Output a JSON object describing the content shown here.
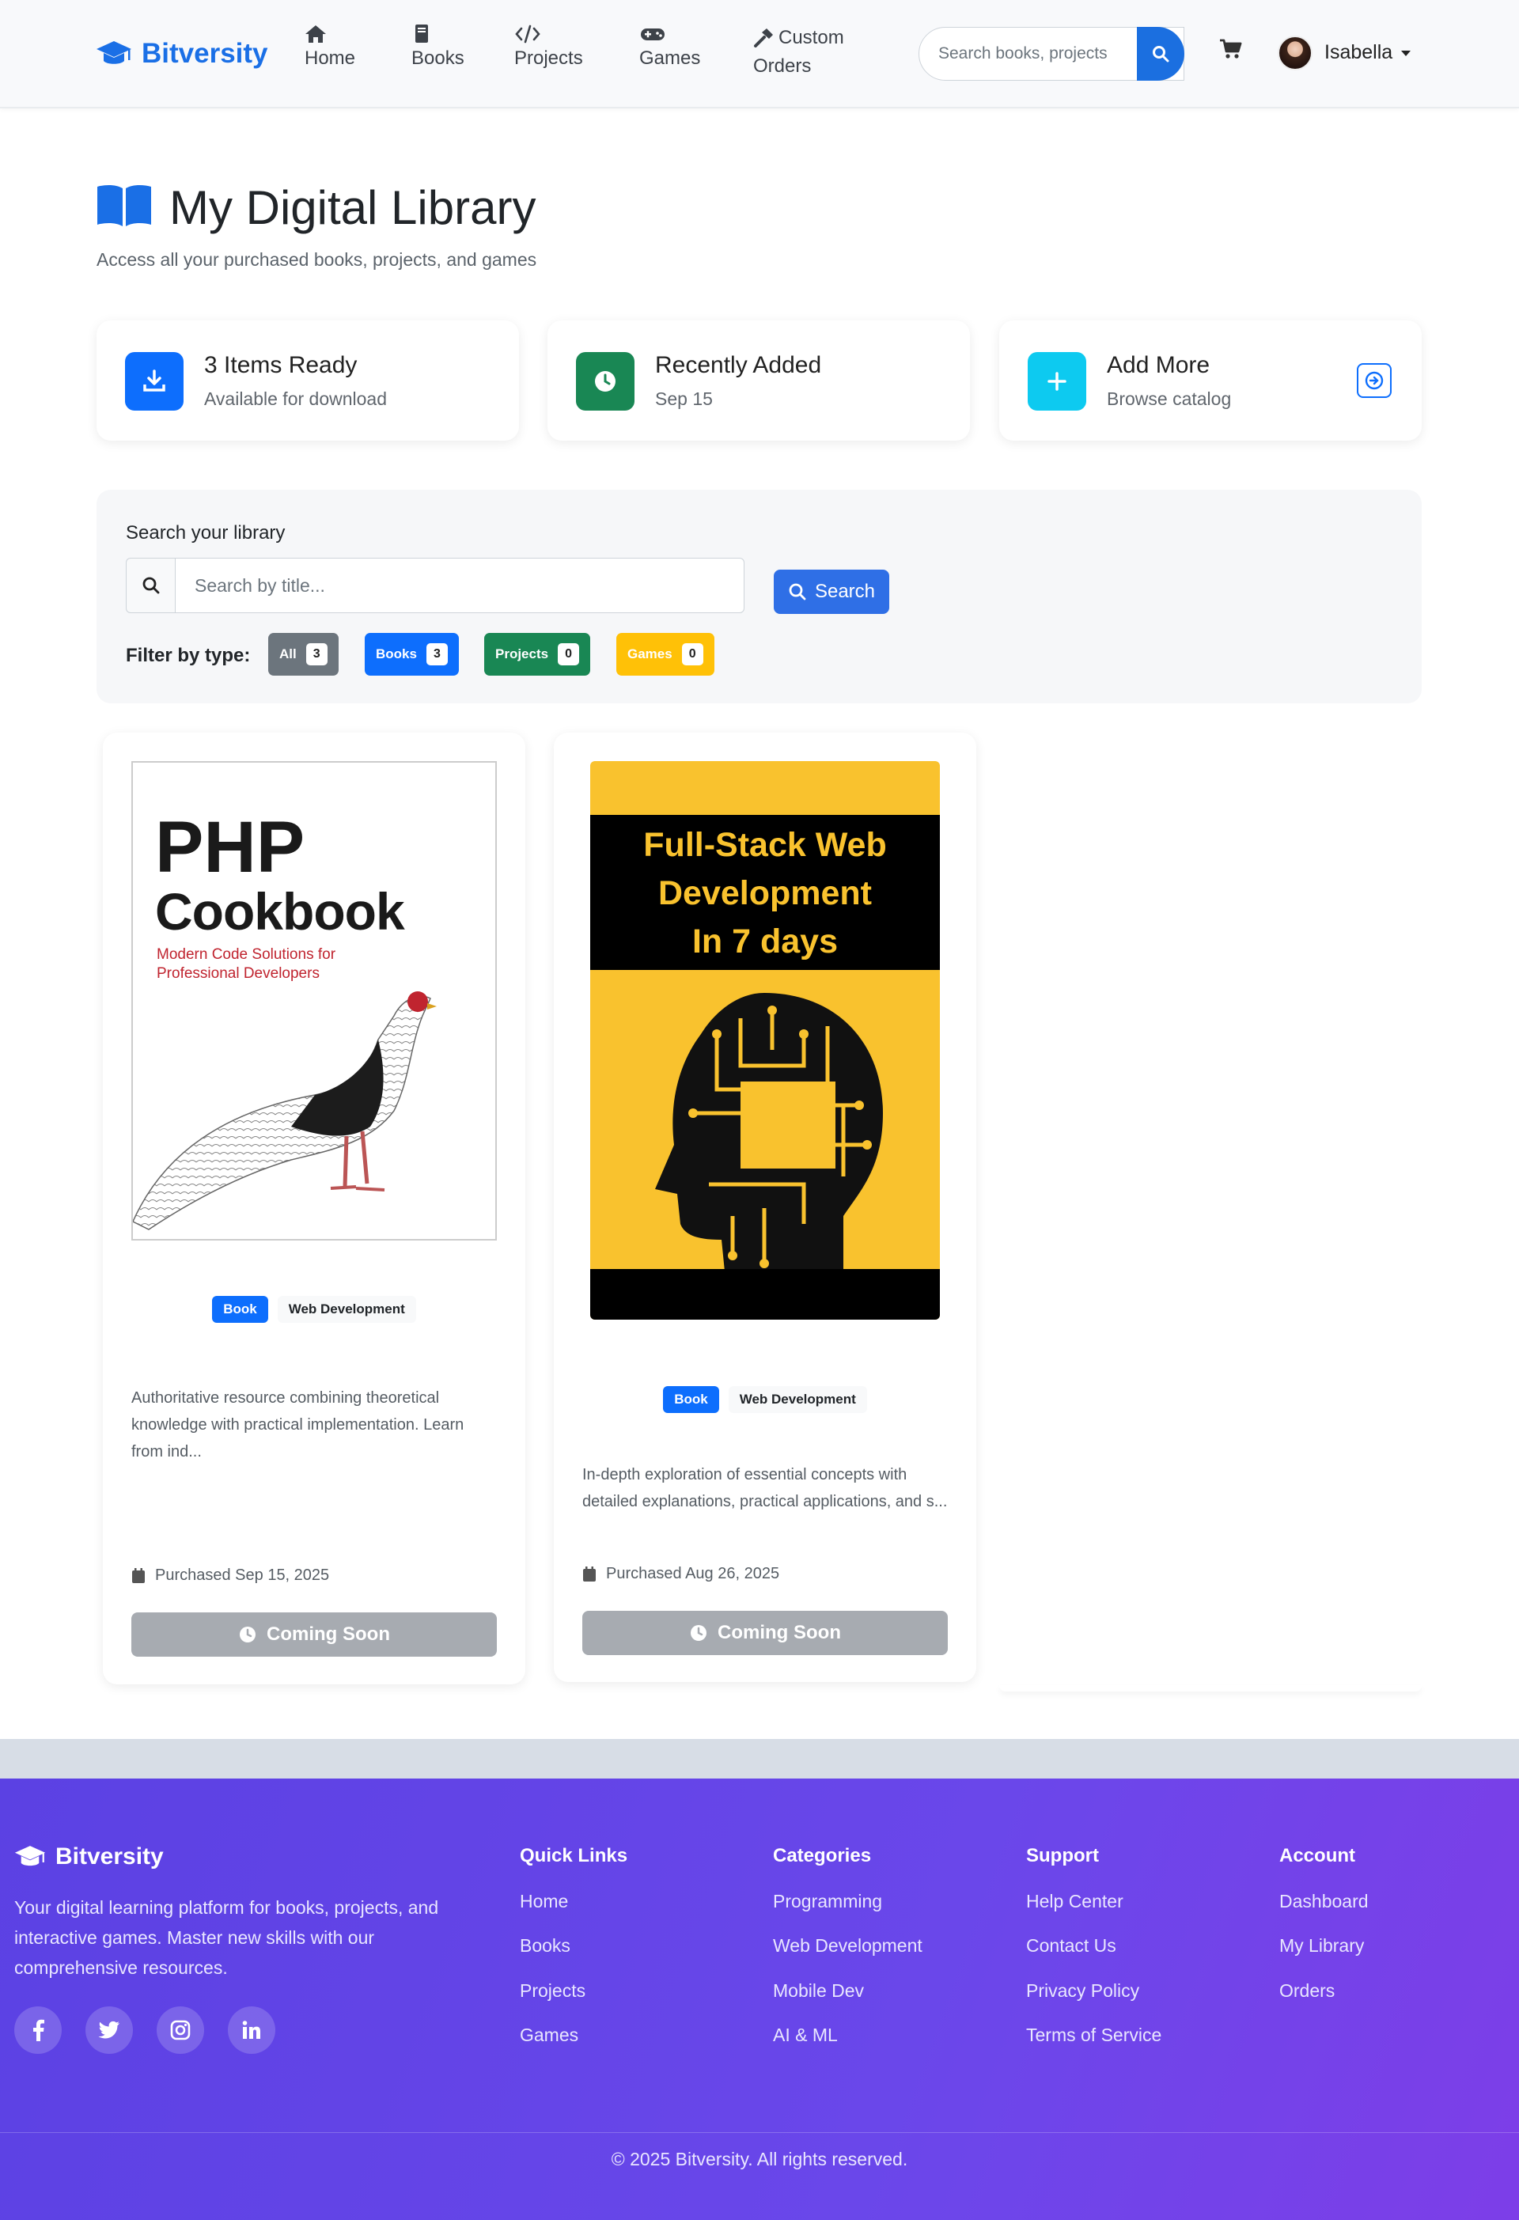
{
  "nav": {
    "brand": "Bitversity",
    "items": [
      {
        "label": "Home",
        "icon": "home-icon"
      },
      {
        "label": "Books",
        "icon": "book-icon"
      },
      {
        "label": "Projects",
        "icon": "code-icon"
      },
      {
        "label": "Games",
        "icon": "gamepad-icon"
      },
      {
        "label_line1": "Custom",
        "label_line2": "Orders",
        "icon": "hammer-icon"
      }
    ],
    "search_placeholder": "Search books, projects",
    "user": "Isabella"
  },
  "header": {
    "title": "My Digital Library",
    "subtitle": "Access all your purchased books, projects, and games"
  },
  "stats": [
    {
      "title": "3 Items Ready",
      "sub": "Available for download",
      "icon": "download-icon",
      "color": "#0d6efd"
    },
    {
      "title": "Recently Added",
      "sub": "Sep 15",
      "icon": "clock-icon",
      "color": "#198754"
    },
    {
      "title": "Add More",
      "sub": "Browse catalog",
      "icon": "plus-icon",
      "color": "#0dcaf0"
    }
  ],
  "library_search": {
    "label": "Search your library",
    "placeholder": "Search by title...",
    "button": "Search",
    "filter_label": "Filter by type:",
    "filters": [
      {
        "label": "All",
        "count": "3",
        "color": "#6c757d"
      },
      {
        "label": "Books",
        "count": "3",
        "color": "#0d6efd"
      },
      {
        "label": "Projects",
        "count": "0",
        "color": "#198754"
      },
      {
        "label": "Games",
        "count": "0",
        "color": "#ffc107"
      }
    ]
  },
  "items": [
    {
      "cover": {
        "title_line1": "PHP",
        "title_line2": "Cookbook",
        "subtitle_line1": "Modern Code Solutions for",
        "subtitle_line2": "Professional Developers"
      },
      "type": "Book",
      "category": "Web Development",
      "description": "Authoritative resource combining theoretical knowledge with practical implementation. Learn from ind...",
      "purchased": "Purchased Sep 15, 2025",
      "button": "Coming Soon"
    },
    {
      "cover": {
        "line1": "Full-Stack Web",
        "line2": "Development",
        "line3": "In 7 days"
      },
      "type": "Book",
      "category": "Web Development",
      "description": "In-depth exploration of essential concepts with detailed explanations, practical applications, and s...",
      "purchased": "Purchased Aug 26, 2025",
      "button": "Coming Soon"
    }
  ],
  "footer": {
    "brand": "Bitversity",
    "description": "Your digital learning platform for books, projects, and interactive games. Master new skills with our comprehensive resources.",
    "columns": [
      {
        "heading": "Quick Links",
        "links": [
          "Home",
          "Books",
          "Projects",
          "Games"
        ]
      },
      {
        "heading": "Categories",
        "links": [
          "Programming",
          "Web Development",
          "Mobile Dev",
          "AI & ML"
        ]
      },
      {
        "heading": "Support",
        "links": [
          "Help Center",
          "Contact Us",
          "Privacy Policy",
          "Terms of Service"
        ]
      },
      {
        "heading": "Account",
        "links": [
          "Dashboard",
          "My Library",
          "Orders"
        ]
      }
    ],
    "copyright": "© 2025 Bitversity. All rights reserved."
  }
}
